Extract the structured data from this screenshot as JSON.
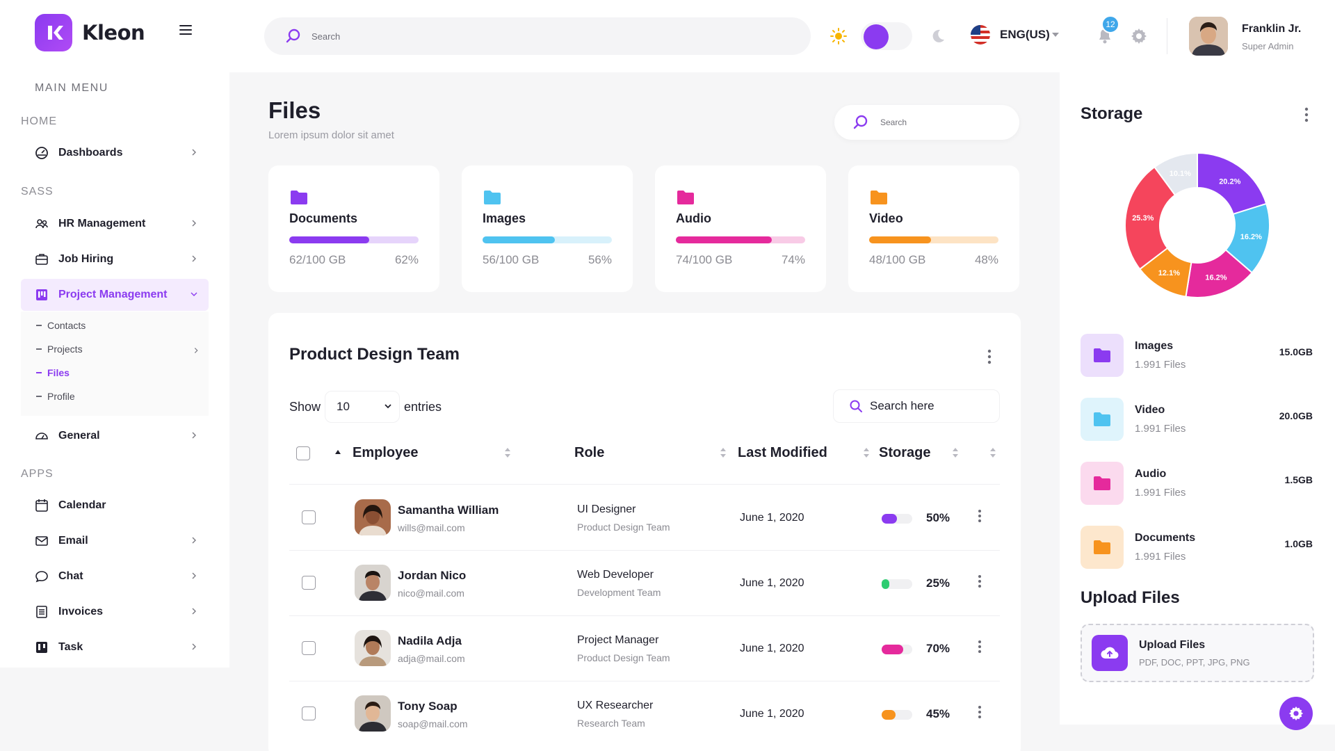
{
  "brand": {
    "name": "Kleon"
  },
  "sidebar": {
    "main_menu_label": "MAIN MENU",
    "sections": {
      "home": "HOME",
      "sass": "SASS",
      "apps": "APPS"
    },
    "items": {
      "dashboards": "Dashboards",
      "hr": "HR Management",
      "job": "Job Hiring",
      "project": "Project Management",
      "general": "General",
      "calendar": "Calendar",
      "email": "Email",
      "chat": "Chat",
      "invoices": "Invoices",
      "task": "Task"
    },
    "submenu": [
      "Contacts",
      "Projects",
      "Files",
      "Profile"
    ]
  },
  "header": {
    "search_placeholder": "Search",
    "language": "ENG(US)",
    "notifications": "12",
    "user": {
      "name": "Franklin Jr.",
      "role": "Super Admin"
    }
  },
  "page": {
    "title": "Files",
    "subtitle": "Lorem ipsum dolor sit amet",
    "search_placeholder": "Search"
  },
  "cards": [
    {
      "title": "Documents",
      "used": "62/100 GB",
      "percent": "62%",
      "fraction": 0.62,
      "color": "#8b3bf0",
      "track": "#e6d4fb"
    },
    {
      "title": "Images",
      "used": "56/100 GB",
      "percent": "56%",
      "fraction": 0.56,
      "color": "#4fc3f0",
      "track": "#d8f1fb"
    },
    {
      "title": "Audio",
      "used": "74/100 GB",
      "percent": "74%",
      "fraction": 0.74,
      "color": "#e52a9c",
      "track": "#f8cbe6"
    },
    {
      "title": "Video",
      "used": "48/100 GB",
      "percent": "48%",
      "fraction": 0.48,
      "color": "#f7931e",
      "track": "#fde3c4"
    }
  ],
  "team": {
    "title": "Product Design Team",
    "show_label": "Show",
    "entries_value": "10",
    "entries_label": "entries",
    "search_placeholder": "Search here",
    "columns": {
      "employee": "Employee",
      "role": "Role",
      "modified": "Last Modified",
      "storage": "Storage"
    },
    "rows": [
      {
        "name": "Samantha William",
        "email": "wills@mail.com",
        "role": "UI Designer",
        "team": "Product Design Team",
        "date": "June 1, 2020",
        "storage": "50%",
        "fraction": 0.5,
        "color": "#8b3bf0"
      },
      {
        "name": "Jordan Nico",
        "email": "nico@mail.com",
        "role": "Web Developer",
        "team": "Development Team",
        "date": "June 1, 2020",
        "storage": "25%",
        "fraction": 0.25,
        "color": "#2ecc71"
      },
      {
        "name": "Nadila Adja",
        "email": "adja@mail.com",
        "role": "Project Manager",
        "team": "Product Design Team",
        "date": "June 1, 2020",
        "storage": "70%",
        "fraction": 0.7,
        "color": "#e52a9c"
      },
      {
        "name": "Tony Soap",
        "email": "soap@mail.com",
        "role": "UX Researcher",
        "team": "Research Team",
        "date": "June 1, 2020",
        "storage": "45%",
        "fraction": 0.45,
        "color": "#f7931e"
      }
    ]
  },
  "storage": {
    "title": "Storage",
    "chart_data": {
      "type": "pie",
      "categories": [
        "purple",
        "blue",
        "pink",
        "orange",
        "red",
        "light-gray"
      ],
      "values": [
        20.2,
        16.2,
        16.2,
        12.1,
        25.3,
        10.1
      ],
      "labels": [
        "20.2%",
        "16.2%",
        "16.2%",
        "12.1%",
        "25.3%",
        "10.1%"
      ],
      "colors": [
        "#8b3bf0",
        "#4fc3f0",
        "#e52a9c",
        "#f7931e",
        "#f5455c",
        "#e4e8ef"
      ]
    },
    "items": [
      {
        "name": "Images",
        "files": "1.991 Files",
        "size": "15.0GB",
        "color": "#8b3bf0",
        "bg": "#ecdffc"
      },
      {
        "name": "Video",
        "files": "1.991 Files",
        "size": "20.0GB",
        "color": "#4fc3f0",
        "bg": "#dff4fc"
      },
      {
        "name": "Audio",
        "files": "1.991 Files",
        "size": "1.5GB",
        "color": "#e52a9c",
        "bg": "#fbdaee"
      },
      {
        "name": "Documents",
        "files": "1.991 Files",
        "size": "1.0GB",
        "color": "#f7931e",
        "bg": "#fde7cd"
      }
    ]
  },
  "upload": {
    "title": "Upload Files",
    "button_label": "Upload Files",
    "formats": "PDF, DOC, PPT, JPG, PNG"
  }
}
